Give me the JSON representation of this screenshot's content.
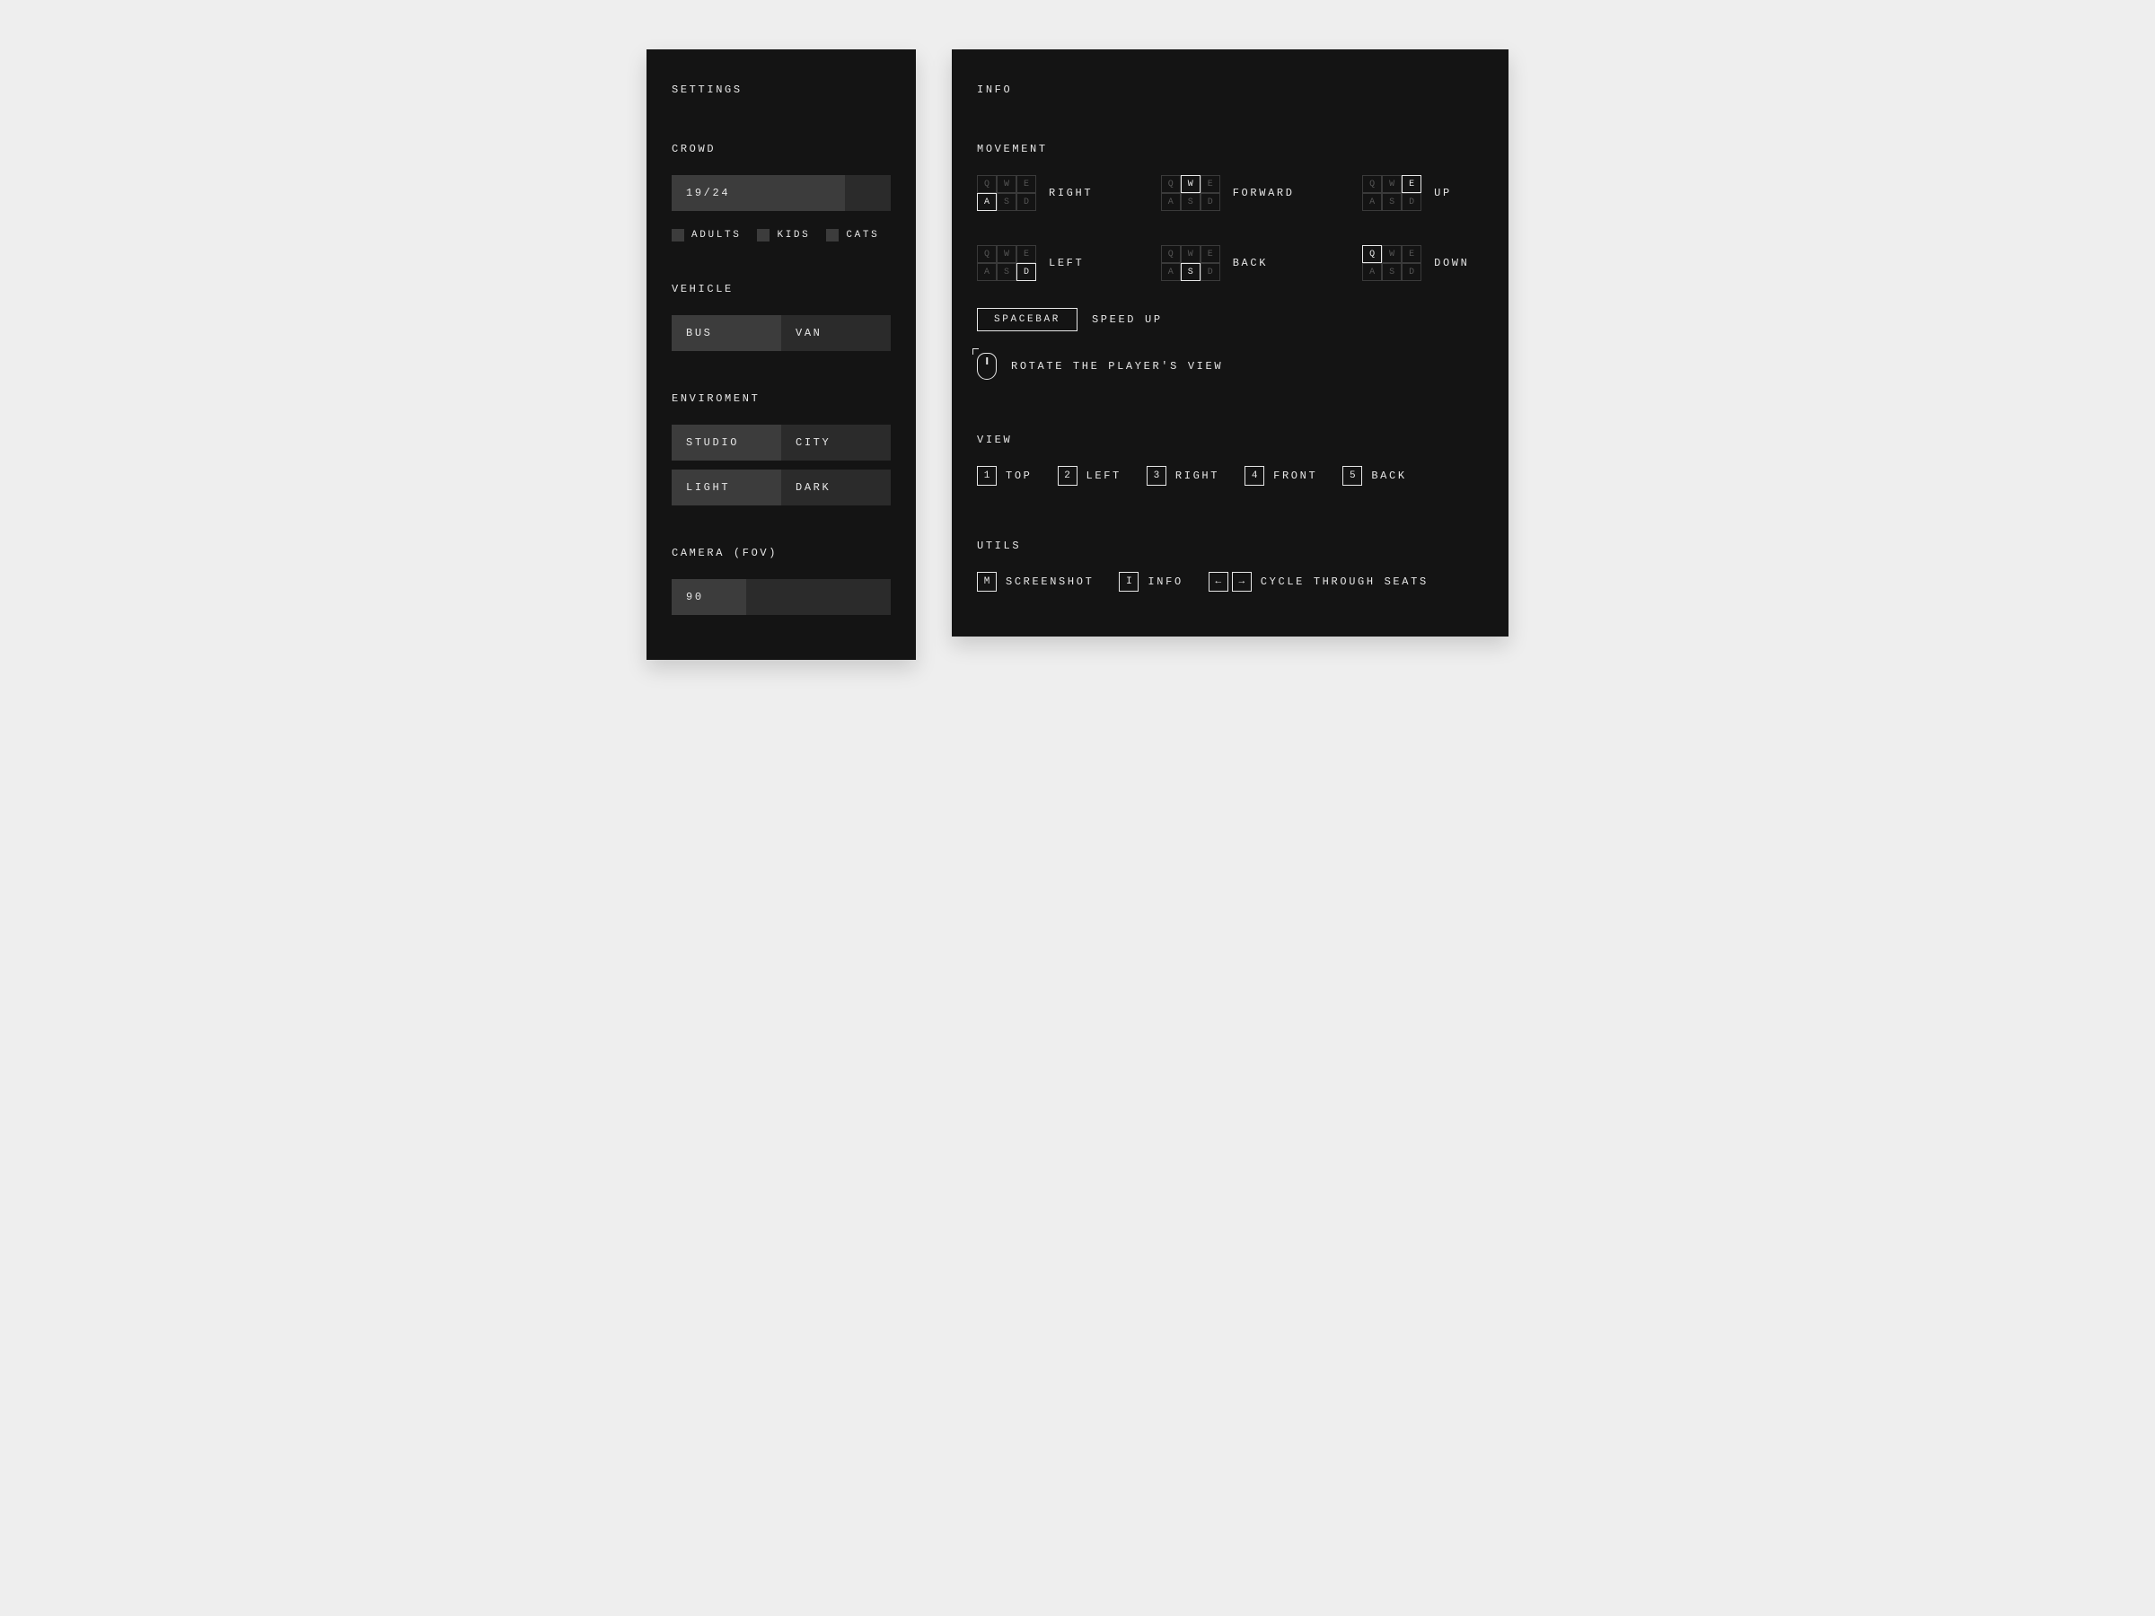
{
  "settings": {
    "title": "SETTINGS",
    "crowd": {
      "label": "CROWD",
      "value_text": "19/24",
      "fill_percent": 79,
      "checks": [
        {
          "label": "ADULTS"
        },
        {
          "label": "KIDS"
        },
        {
          "label": "CATS"
        }
      ]
    },
    "vehicle": {
      "label": "VEHICLE",
      "options": [
        "BUS",
        "VAN"
      ],
      "active_index": 0
    },
    "environment": {
      "label": "ENVIROMENT",
      "row1": {
        "options": [
          "STUDIO",
          "CITY"
        ],
        "active_index": 0
      },
      "row2": {
        "options": [
          "LIGHT",
          "DARK"
        ],
        "active_index": 0
      }
    },
    "camera": {
      "label": "CAMERA (FOV)",
      "value_text": "90",
      "fill_percent": 34
    }
  },
  "info": {
    "title": "INFO",
    "movement": {
      "label": "MOVEMENT",
      "keys_layout": [
        "Q",
        "W",
        "E",
        "A",
        "S",
        "D"
      ],
      "items": [
        {
          "label": "RIGHT",
          "highlight": "A"
        },
        {
          "label": "FORWARD",
          "highlight": "W"
        },
        {
          "label": "UP",
          "highlight": "E"
        },
        {
          "label": "LEFT",
          "highlight": "D"
        },
        {
          "label": "BACK",
          "highlight": "S"
        },
        {
          "label": "DOWN",
          "highlight": "Q"
        }
      ],
      "spacebar_label": "SPACEBAR",
      "spacebar_action": "SPEED UP",
      "mouse_action": "ROTATE THE PLAYER'S VIEW"
    },
    "view": {
      "label": "VIEW",
      "items": [
        {
          "key": "1",
          "label": "TOP"
        },
        {
          "key": "2",
          "label": "LEFT"
        },
        {
          "key": "3",
          "label": "RIGHT"
        },
        {
          "key": "4",
          "label": "FRONT"
        },
        {
          "key": "5",
          "label": "BACK"
        }
      ]
    },
    "utils": {
      "label": "UTILS",
      "items": [
        {
          "key": "M",
          "label": "SCREENSHOT"
        },
        {
          "key": "I",
          "label": "INFO"
        }
      ],
      "arrows": {
        "left": "←",
        "right": "→",
        "label": "CYCLE THROUGH SEATS"
      }
    }
  }
}
